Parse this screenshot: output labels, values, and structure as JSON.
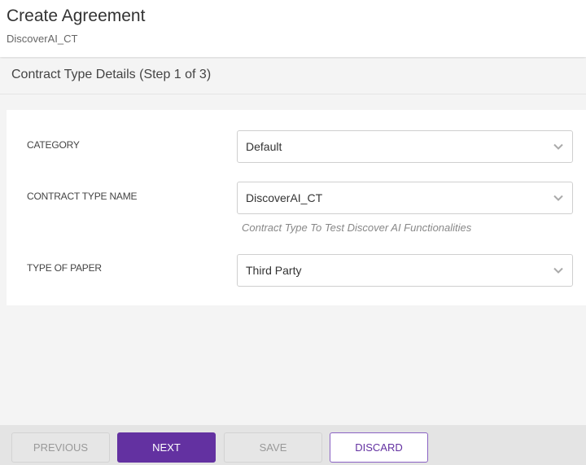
{
  "header": {
    "title": "Create Agreement",
    "subtitle": "DiscoverAI_CT"
  },
  "step": {
    "title": "Contract Type Details (Step 1 of 3)"
  },
  "form": {
    "fields": [
      {
        "label": "CATEGORY",
        "value": "Default"
      },
      {
        "label": "CONTRACT TYPE NAME",
        "value": "DiscoverAI_CT",
        "hint": "Contract Type To Test Discover AI Functionalities"
      },
      {
        "label": "TYPE OF PAPER",
        "value": "Third Party"
      }
    ]
  },
  "footer": {
    "previous_label": "PREVIOUS",
    "next_label": "NEXT",
    "save_label": "SAVE",
    "discard_label": "DISCARD"
  },
  "colors": {
    "accent": "#6331a1",
    "disabled_bg": "#e6e6e6"
  }
}
